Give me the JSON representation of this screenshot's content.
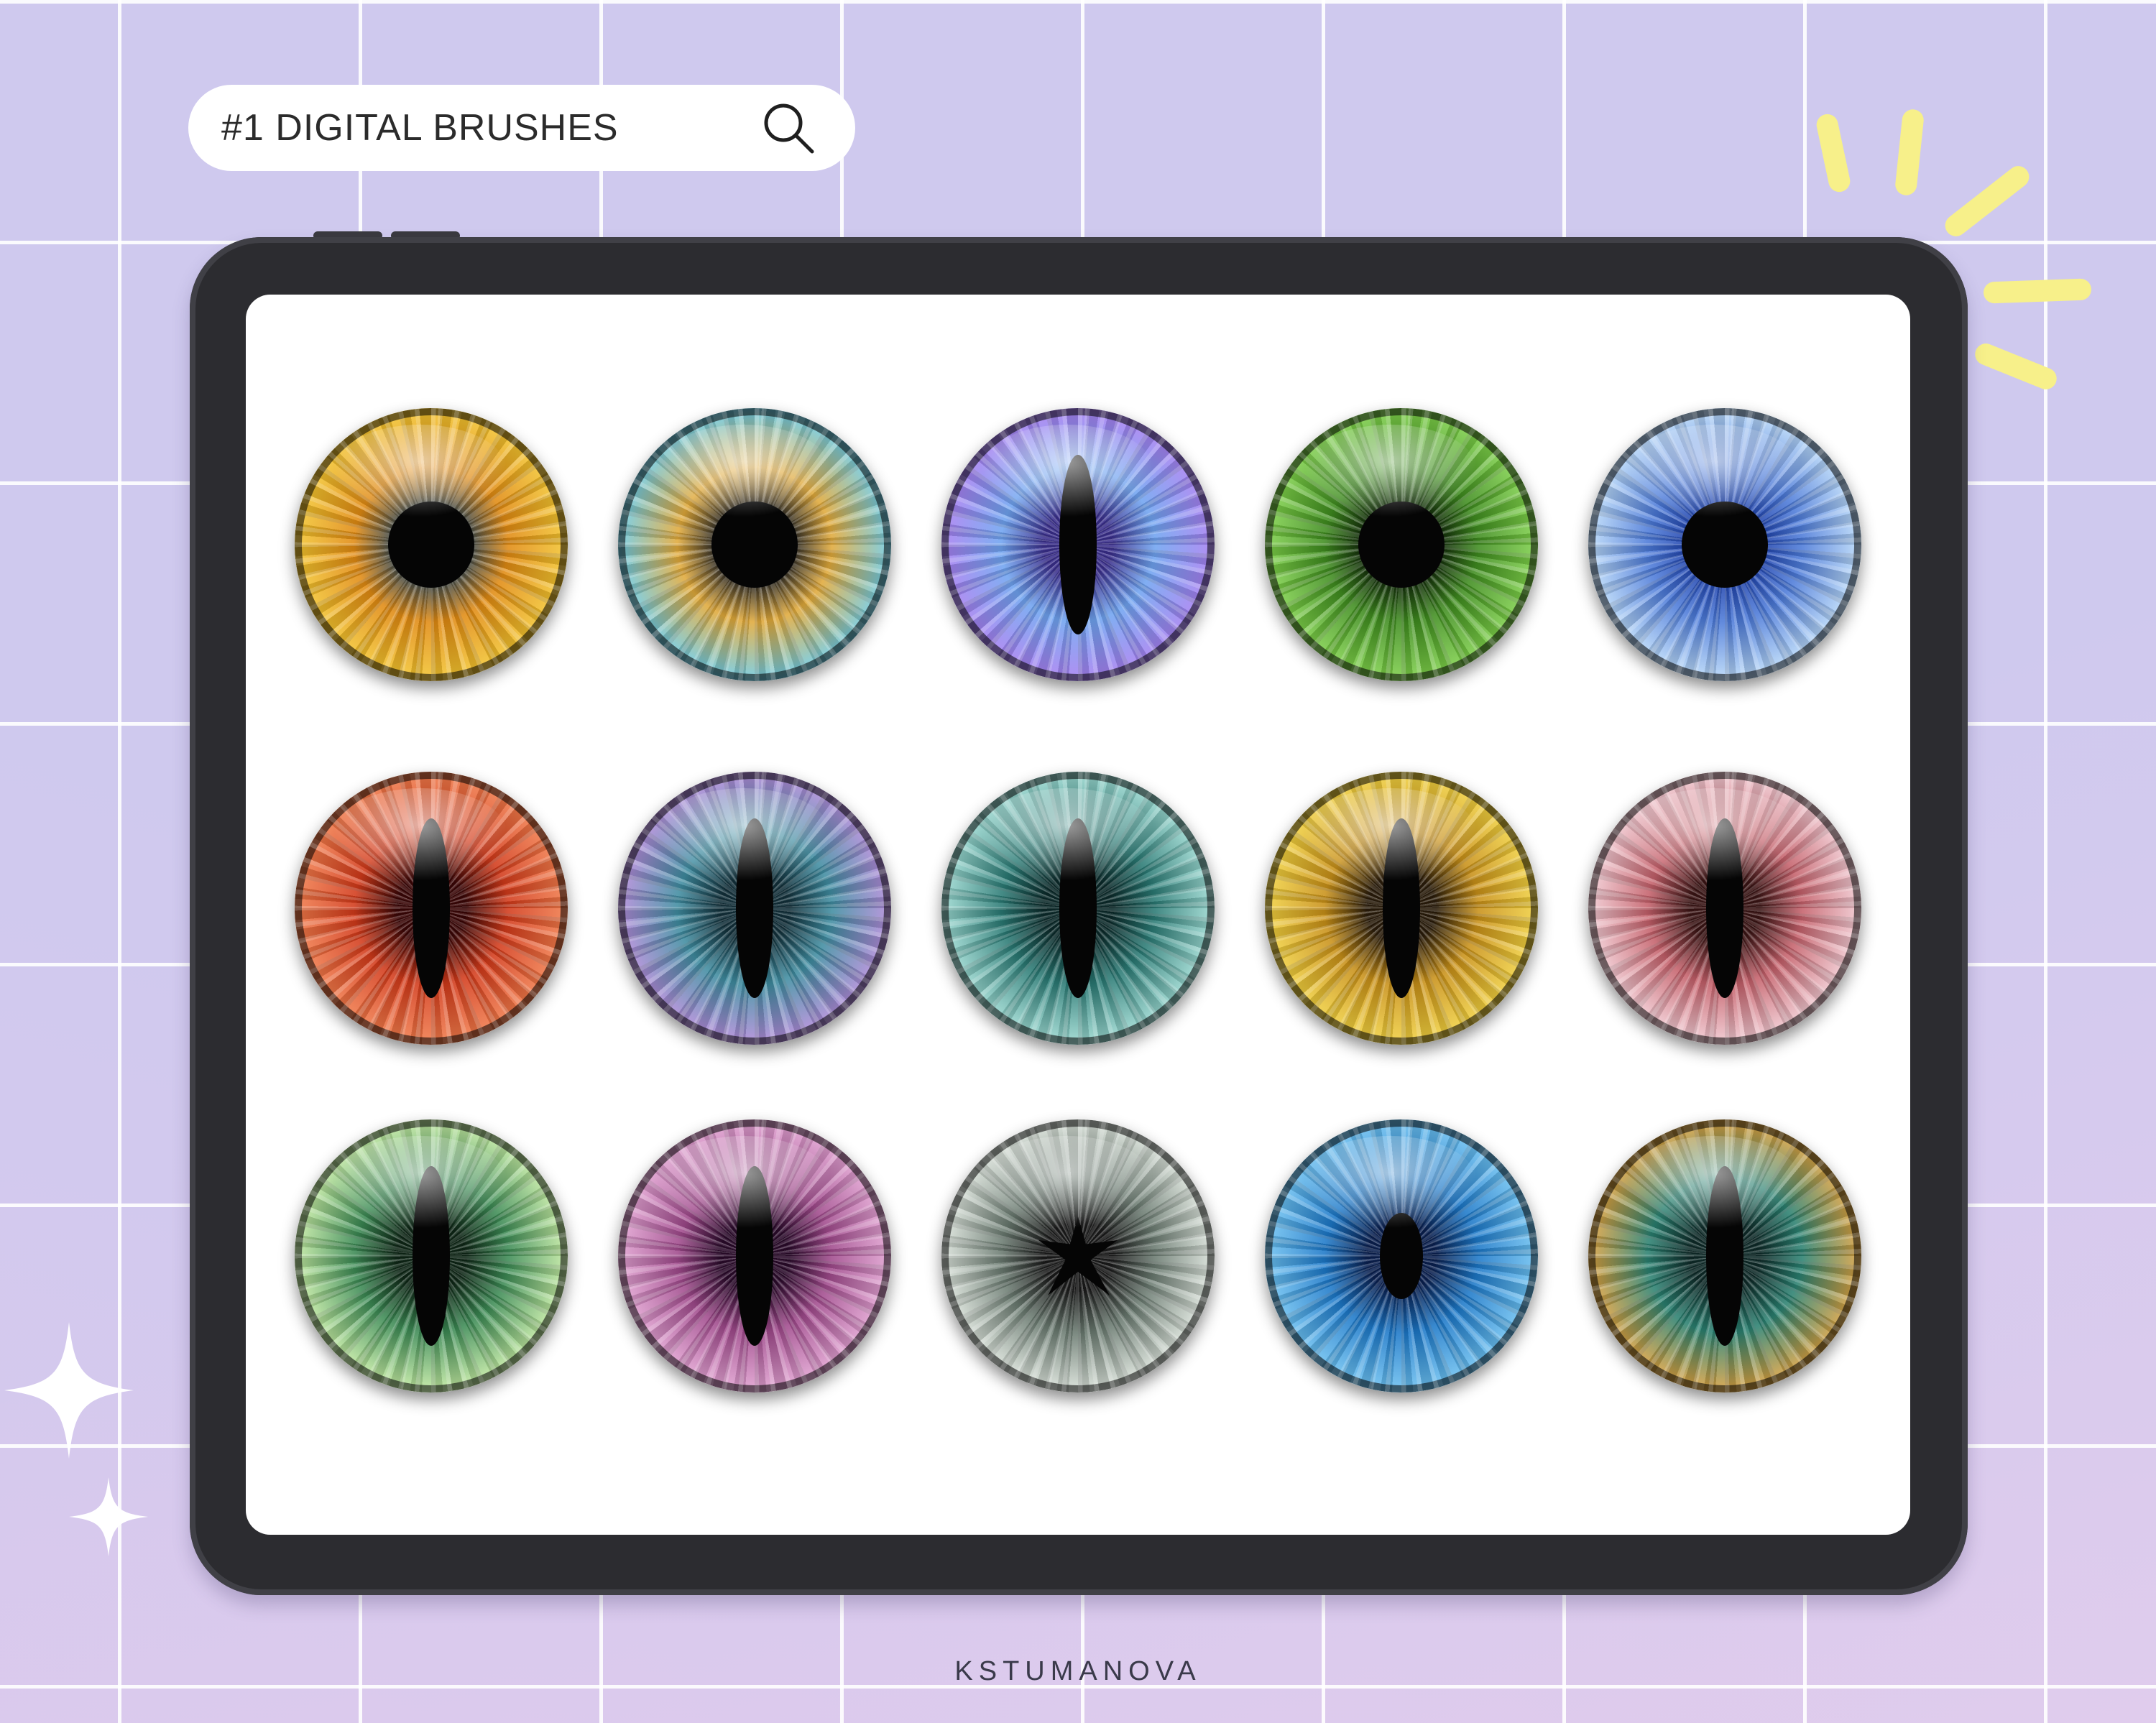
{
  "search": {
    "text": "#1 DIGITAL BRUSHES",
    "icon": "search-icon"
  },
  "brand": "KSTUMANOVA",
  "colors": {
    "background": "#cfc9ee",
    "grid_line": "#ffffff",
    "tablet_frame": "#2c2c30",
    "screen": "#ffffff",
    "accent_rays": "#f7f08a"
  },
  "eyes": [
    {
      "name": "eye-amber-sunburst",
      "iris": [
        "#2b4252",
        "#e08a12",
        "#f2c430"
      ],
      "pupil": "round"
    },
    {
      "name": "eye-cyan-gold-ring",
      "iris": [
        "#1a1e26",
        "#e0a93a",
        "#6fc9e0"
      ],
      "pupil": "round"
    },
    {
      "name": "eye-violet-blue-slit",
      "iris": [
        "#3a2f8c",
        "#6fa3f0",
        "#a67ff0"
      ],
      "pupil": "slit"
    },
    {
      "name": "eye-green",
      "iris": [
        "#0d1f08",
        "#3f8c1f",
        "#7ed04a"
      ],
      "pupil": "round"
    },
    {
      "name": "eye-electric-blue",
      "iris": [
        "#1c3ea8",
        "#4c7ad8",
        "#b8d8f8"
      ],
      "pupil": "round"
    },
    {
      "name": "eye-red-slit",
      "iris": [
        "#3a0606",
        "#d23a1a",
        "#f07a4a"
      ],
      "pupil": "slit"
    },
    {
      "name": "eye-teal-purple-slit",
      "iris": [
        "#12303a",
        "#3f8ca0",
        "#b08ad8"
      ],
      "pupil": "slit"
    },
    {
      "name": "eye-dark-teal-slit",
      "iris": [
        "#0b2a2a",
        "#2a7a74",
        "#9ad8d0"
      ],
      "pupil": "slit"
    },
    {
      "name": "eye-gold-slit",
      "iris": [
        "#2a1c0a",
        "#c89018",
        "#f0d040"
      ],
      "pupil": "slit"
    },
    {
      "name": "eye-pink-slit",
      "iris": [
        "#3a1414",
        "#c4606a",
        "#f0c8d0"
      ],
      "pupil": "slit"
    },
    {
      "name": "eye-green-glow-slit",
      "iris": [
        "#0e2616",
        "#3c8a54",
        "#c0e8a0"
      ],
      "pupil": "slit"
    },
    {
      "name": "eye-magenta-slit",
      "iris": [
        "#2a0a2a",
        "#a04a8c",
        "#e0a0d0"
      ],
      "pupil": "slit"
    },
    {
      "name": "eye-cracked-silver",
      "iris": [
        "#1a1a1a",
        "#6a7a70",
        "#d8e0d8"
      ],
      "pupil": "cracked"
    },
    {
      "name": "eye-bright-blue",
      "iris": [
        "#0a2050",
        "#1c78c8",
        "#6cc0f0"
      ],
      "pupil": "round-small"
    },
    {
      "name": "eye-teal-rainbow-slit",
      "iris": [
        "#0e2a28",
        "#2a8070",
        "#d8a040"
      ],
      "pupil": "slit"
    }
  ]
}
